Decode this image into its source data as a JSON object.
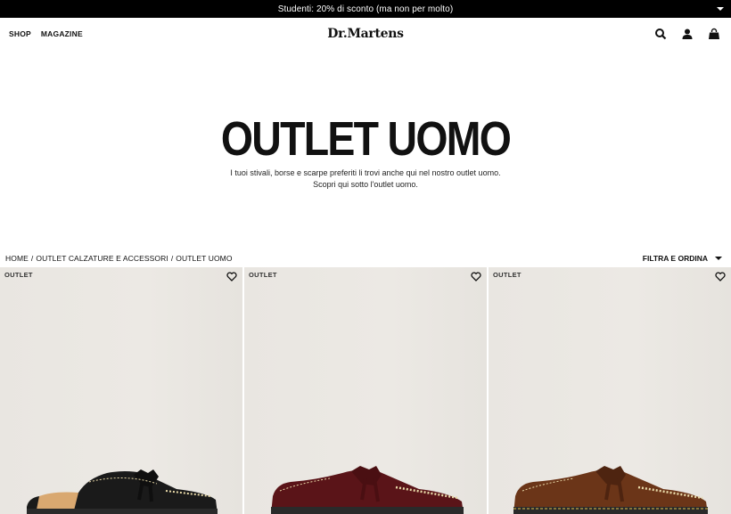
{
  "promo": {
    "text": "Studenti: 20% di sconto (ma non per molto)"
  },
  "header": {
    "nav": [
      "SHOP",
      "MAGAZINE"
    ],
    "logo": "Dr.Martens",
    "icons": [
      "search-icon",
      "account-icon",
      "bag-icon"
    ]
  },
  "hero": {
    "title": "OUTLET UOMO",
    "description": "I tuoi stivali, borse e scarpe preferiti li trovi anche qui nel nostro outlet uomo. Scopri qui sotto l'outlet uomo."
  },
  "breadcrumb": [
    "HOME",
    "/",
    "OUTLET CALZATURE E ACCESSORI",
    "/",
    "OUTLET UOMO"
  ],
  "filter": {
    "label": "FILTRA E ORDINA"
  },
  "products": [
    {
      "badge": "OUTLET",
      "color": "#1a1a1a",
      "sole": "#2a2a2a",
      "kind": "mule"
    },
    {
      "badge": "OUTLET",
      "color": "#5a1418",
      "sole": "#2a2a2a",
      "kind": "loafer"
    },
    {
      "badge": "OUTLET",
      "color": "#6b3518",
      "sole": "#2a2a2a",
      "kind": "loafer"
    }
  ],
  "colors": {
    "promo_bg": "#000000",
    "card_bg": "#ebe8e3",
    "stitch": "#e8d9a8"
  }
}
